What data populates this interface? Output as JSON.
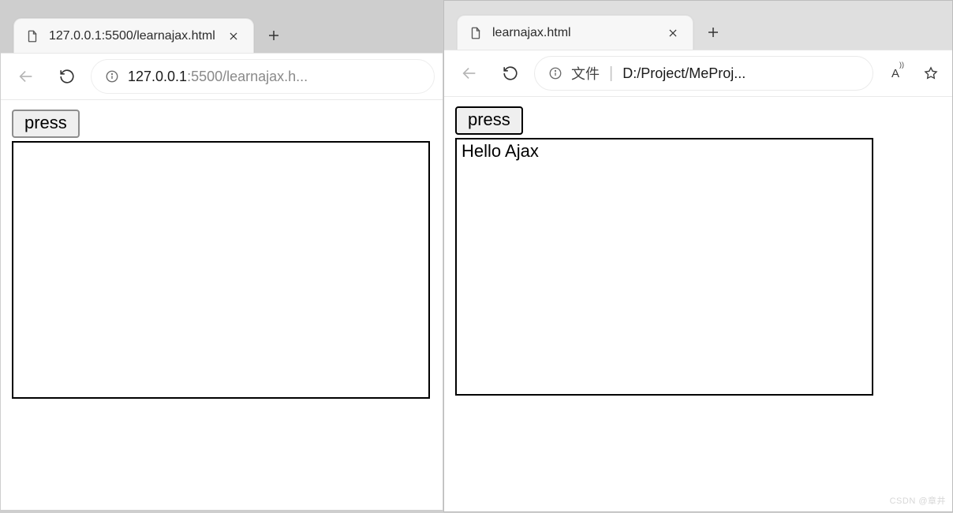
{
  "windows": {
    "left": {
      "tab": {
        "title": "127.0.0.1:5500/learnajax.html"
      },
      "url_host": "127.0.0.1",
      "url_path": ":5500/learnajax.h...",
      "button_label": "press",
      "result_text": ""
    },
    "right": {
      "tab": {
        "title": "learnajax.html"
      },
      "file_label": "文件",
      "url_text": "D:/Project/MeProj...",
      "button_label": "press",
      "result_text": "Hello Ajax",
      "read_aloud_label": "A",
      "read_aloud_sup": "))"
    }
  },
  "watermark": "CSDN @章井"
}
